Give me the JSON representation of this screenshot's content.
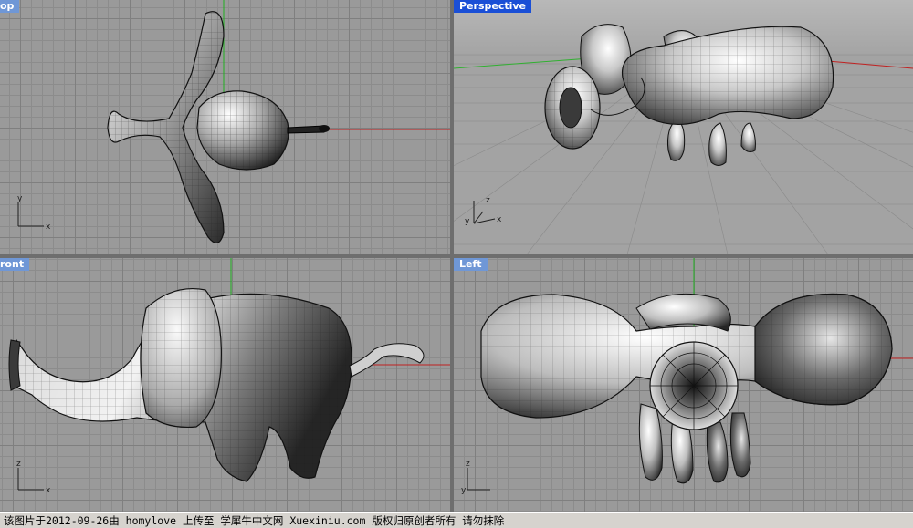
{
  "viewports": {
    "top": {
      "label": "op"
    },
    "perspective": {
      "label": "Perspective"
    },
    "front": {
      "label": "ront"
    },
    "left": {
      "label": "Left"
    }
  },
  "axes": {
    "x": "x",
    "y": "y",
    "z": "z"
  },
  "colors": {
    "x_axis": "#c02020",
    "y_axis": "#20b020",
    "tab_active": "#1a4fd6",
    "tab_inactive": "#6f97d6",
    "grid_bg": "#9a9a9a"
  },
  "status": {
    "text": "该图片于2012-09-26由 homylove 上传至 学犀牛中文网 Xuexiniu.com 版权归原创者所有 请勿抹除"
  }
}
